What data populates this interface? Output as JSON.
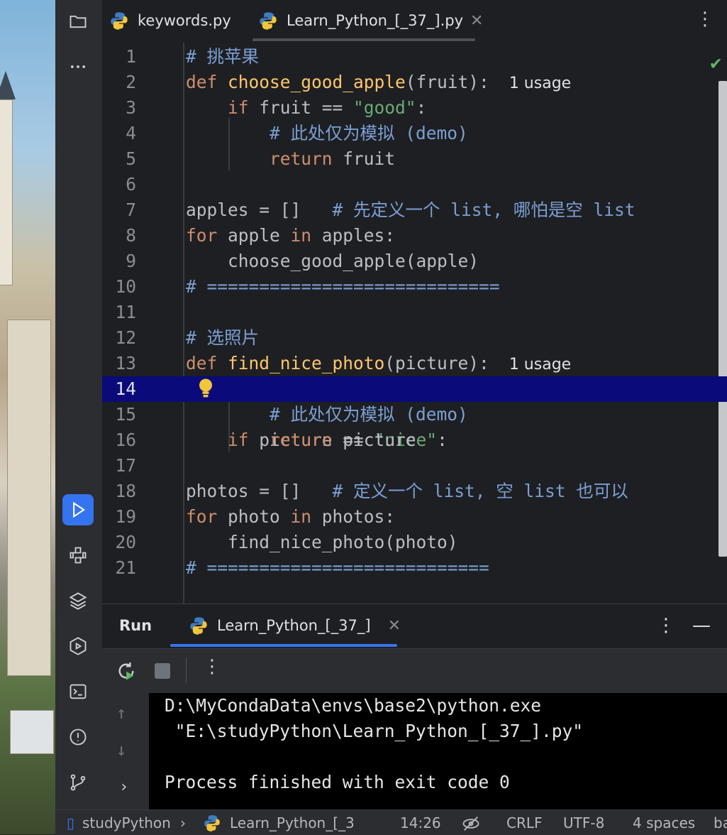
{
  "tabs": [
    {
      "label": "keywords.py",
      "icon": "python-icon"
    },
    {
      "label": "Learn_Python_[_37_].py",
      "icon": "python-icon",
      "active": true
    }
  ],
  "editor": {
    "lines": [
      {
        "n": "1"
      },
      {
        "n": "2"
      },
      {
        "n": "3"
      },
      {
        "n": "4"
      },
      {
        "n": "5"
      },
      {
        "n": "6"
      },
      {
        "n": "7"
      },
      {
        "n": "8"
      },
      {
        "n": "9"
      },
      {
        "n": "10"
      },
      {
        "n": "11"
      },
      {
        "n": "12"
      },
      {
        "n": "13"
      },
      {
        "n": "14"
      },
      {
        "n": "15"
      },
      {
        "n": "16"
      },
      {
        "n": "17"
      },
      {
        "n": "18"
      },
      {
        "n": "19"
      },
      {
        "n": "20"
      },
      {
        "n": "21"
      }
    ],
    "code": {
      "l1": "# 挑苹果",
      "l2_kw": "def",
      "l2_fn": "choose_good_apple",
      "l2_rest": "(fruit):",
      "l3_kw": "if",
      "l3_a": " fruit == ",
      "l3_str": "\"good\"",
      "l3_b": ":",
      "l4": "# 此处仅为模拟 (demo)",
      "l5_kw": "return",
      "l5_rest": " fruit",
      "l7_a": "apples = []   ",
      "l7_cm": "# 先定义一个 list, 哪怕是空 list",
      "l8_kw": "for",
      "l8_a": " apple ",
      "l8_kw2": "in",
      "l8_b": " apples:",
      "l9": "    choose_good_apple(apple)",
      "l10": "# ============================",
      "l12": "# 选照片",
      "l13_kw": "def",
      "l13_fn": "find_nice_photo",
      "l13_rest": "(picture):",
      "l14_kw": "if",
      "l14_a": " picture == ",
      "l14_str": "\"nice\"",
      "l14_b": ":",
      "l15": "# 此处仅为模拟 (demo)",
      "l16_kw": "return",
      "l16_rest": " picture",
      "l18_a": "photos = []   ",
      "l18_cm": "# 定义一个 list, 空 list 也可以",
      "l19_kw": "for",
      "l19_a": " photo ",
      "l19_kw2": "in",
      "l19_b": " photos:",
      "l20": "    find_nice_photo(photo)",
      "l21": "# ==========================="
    },
    "usage_hint": "1 usage"
  },
  "run": {
    "title": "Run",
    "tab_label": "Learn_Python_[_37_]",
    "console": [
      "D:\\MyCondaData\\envs\\base2\\python.exe",
      " \"E:\\studyPython\\Learn_Python_[_37_].py\"",
      "",
      "Process finished with exit code 0"
    ]
  },
  "status": {
    "project": "studyPython",
    "file": "Learn_Python_[_3",
    "position": "14:26",
    "line_sep": "CRLF",
    "encoding": "UTF-8",
    "indent": "4 spaces",
    "interpreter": "ba"
  }
}
